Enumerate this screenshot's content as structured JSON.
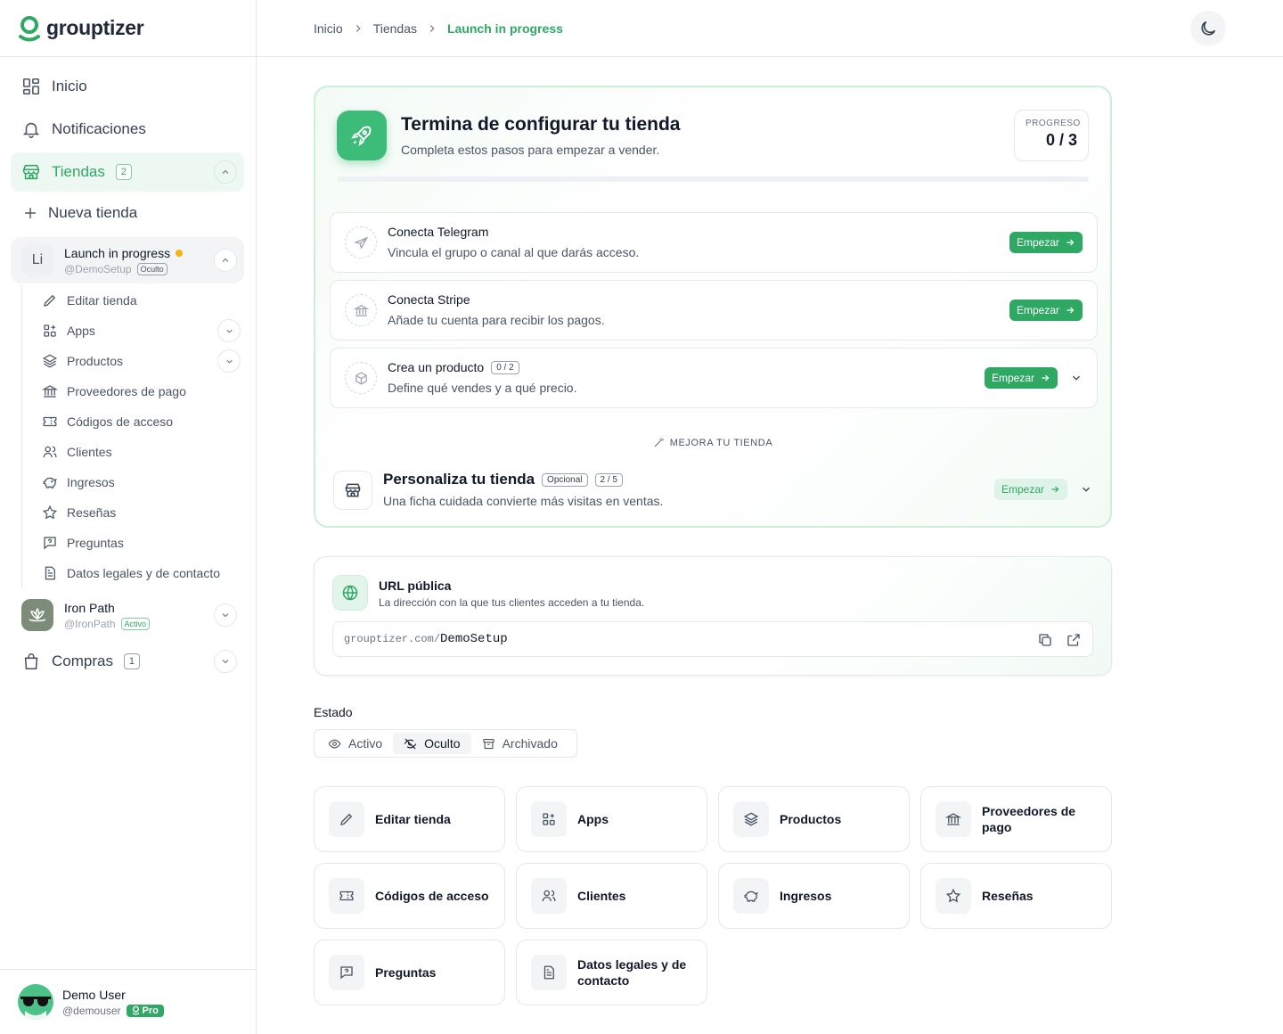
{
  "app": {
    "name": "grouptizer"
  },
  "sidebar": {
    "nav": {
      "inicio": "Inicio",
      "notificaciones": "Notificaciones",
      "tiendas": "Tiendas",
      "tiendas_count": "2",
      "nueva_tienda": "Nueva tienda",
      "compras": "Compras",
      "compras_count": "1"
    },
    "stores": [
      {
        "initials": "Li",
        "name": "Launch in progress",
        "handle": "@DemoSetup",
        "status": "Oculto"
      },
      {
        "name": "Iron Path",
        "handle": "@IronPath",
        "status": "Activo"
      }
    ],
    "store_menu": [
      {
        "label": "Editar tienda",
        "icon": "pencil-icon"
      },
      {
        "label": "Apps",
        "icon": "apps-grid-icon"
      },
      {
        "label": "Productos",
        "icon": "layers-icon"
      },
      {
        "label": "Proveedores de pago",
        "icon": "bank-icon"
      },
      {
        "label": "Códigos de acceso",
        "icon": "ticket-icon"
      },
      {
        "label": "Clientes",
        "icon": "users-icon"
      },
      {
        "label": "Ingresos",
        "icon": "piggy-bank-icon"
      },
      {
        "label": "Reseñas",
        "icon": "star-icon"
      },
      {
        "label": "Preguntas",
        "icon": "message-question-icon"
      },
      {
        "label": "Datos legales y de contacto",
        "icon": "document-icon"
      }
    ],
    "user": {
      "name": "Demo User",
      "handle": "@demouser",
      "plan": "Pro"
    }
  },
  "header": {
    "breadcrumb": [
      "Inicio",
      "Tiendas",
      "Launch in progress"
    ]
  },
  "setup": {
    "title": "Termina de configurar tu tienda",
    "subtitle": "Completa estos pasos para empezar a vender.",
    "progress_label": "PROGRESO",
    "progress_value": "0 / 3",
    "progress_fraction": 0,
    "steps": [
      {
        "title": "Conecta Telegram",
        "subtitle": "Vincula el grupo o canal al que darás acceso.",
        "button": "Empezar"
      },
      {
        "title": "Conecta Stripe",
        "subtitle": "Añade tu cuenta para recibir los pagos.",
        "button": "Empezar"
      },
      {
        "title": "Crea un producto",
        "count": "0 / 2",
        "subtitle": "Define qué vendes y a qué precio.",
        "button": "Empezar"
      }
    ],
    "improve_label": "MEJORA TU TIENDA",
    "personalize": {
      "title": "Personaliza tu tienda",
      "optional": "Opcional",
      "count": "2 / 5",
      "subtitle": "Una ficha cuidada convierte más visitas en ventas.",
      "button": "Empezar"
    }
  },
  "url_card": {
    "title": "URL pública",
    "subtitle": "La dirección con la que tus clientes acceden a tu tienda.",
    "host": "grouptizer.com/",
    "path": "DemoSetup"
  },
  "estado": {
    "label": "Estado",
    "options": [
      "Activo",
      "Oculto",
      "Archivado"
    ],
    "selected": "Oculto"
  },
  "tiles": [
    {
      "label": "Editar tienda",
      "icon": "pencil-icon"
    },
    {
      "label": "Apps",
      "icon": "apps-grid-icon"
    },
    {
      "label": "Productos",
      "icon": "layers-icon"
    },
    {
      "label": "Proveedores de pago",
      "icon": "bank-icon"
    },
    {
      "label": "Códigos de acceso",
      "icon": "ticket-icon"
    },
    {
      "label": "Clientes",
      "icon": "users-icon"
    },
    {
      "label": "Ingresos",
      "icon": "piggy-bank-icon"
    },
    {
      "label": "Reseñas",
      "icon": "star-icon"
    },
    {
      "label": "Preguntas",
      "icon": "message-question-icon"
    },
    {
      "label": "Datos legales y de contacto",
      "icon": "document-icon"
    }
  ],
  "colors": {
    "accent": "#2fa864",
    "accent_soft": "#eef8f2",
    "status_dot": "#f5b40b"
  }
}
